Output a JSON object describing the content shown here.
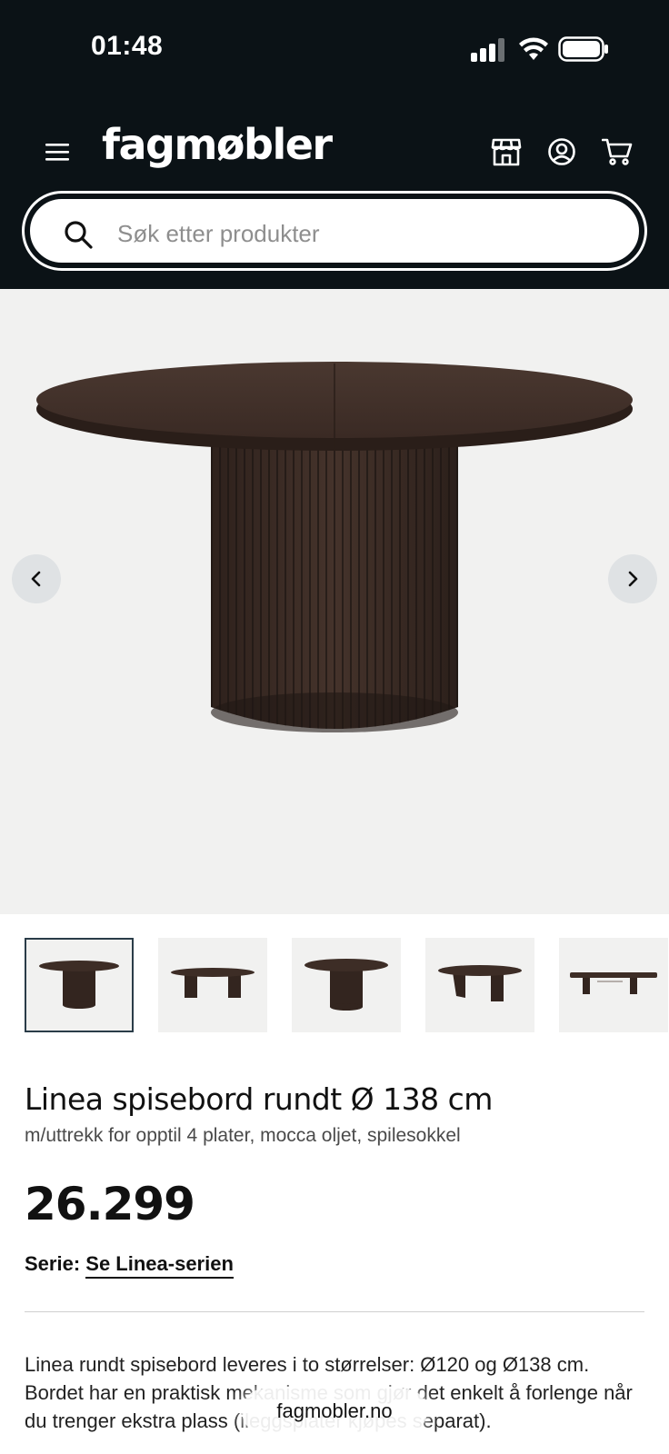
{
  "status_bar": {
    "time": "01:48"
  },
  "header": {
    "logo": "fagmøbler",
    "icons": [
      "menu-icon",
      "store-icon",
      "account-icon",
      "cart-icon"
    ]
  },
  "search": {
    "placeholder": "Søk etter produkter",
    "value": ""
  },
  "gallery": {
    "thumbnail_count_visible": 5,
    "active_index": 0
  },
  "product": {
    "title": "Linea spisebord rundt Ø 138 cm",
    "subtitle": "m/uttrekk for opptil 4 plater, mocca oljet, spilesokkel",
    "price": "26.299",
    "series_label": "Serie:",
    "series_link": "Se Linea-serien",
    "description": "Linea rundt spisebord leveres i to størrelser: Ø120 og Ø138 cm. Bordet har en praktisk mekanisme som gjør det enkelt å forlenge når du trenger ekstra plass (ileggsplater kjøpes separat)."
  },
  "browser": {
    "url": "fagmobler.no"
  },
  "colors": {
    "header_bg": "#0b1216",
    "gallery_bg": "#f1f1f0",
    "table_wood": "#3a2a24",
    "active_thumb_border": "#2a3c48"
  }
}
